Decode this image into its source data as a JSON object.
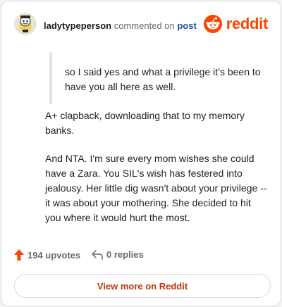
{
  "header": {
    "username": "ladytypeperson",
    "action_text": "commented on",
    "post_link": "post",
    "brand_name": "reddit",
    "brand_color": "#ff4500"
  },
  "comment": {
    "quote": "so I said yes and what a privilege it’s been to have you all here as well.",
    "paragraphs": [
      "A+ clapback, downloading that to my memory banks.",
      "And NTA. I'm sure every mom wishes she could have a Zara. You SIL's wish has festered into jealousy. Her little dig wasn't about your privilege -- it was about your mothering. She decided to hit you where it would hurt the most."
    ]
  },
  "actions": {
    "upvotes_label": "194 upvotes",
    "replies_label": "0 replies",
    "upvote_icon": "upvote-arrow-icon",
    "reply_icon": "reply-arrow-icon"
  },
  "footer": {
    "view_more_label": "View more on Reddit"
  }
}
